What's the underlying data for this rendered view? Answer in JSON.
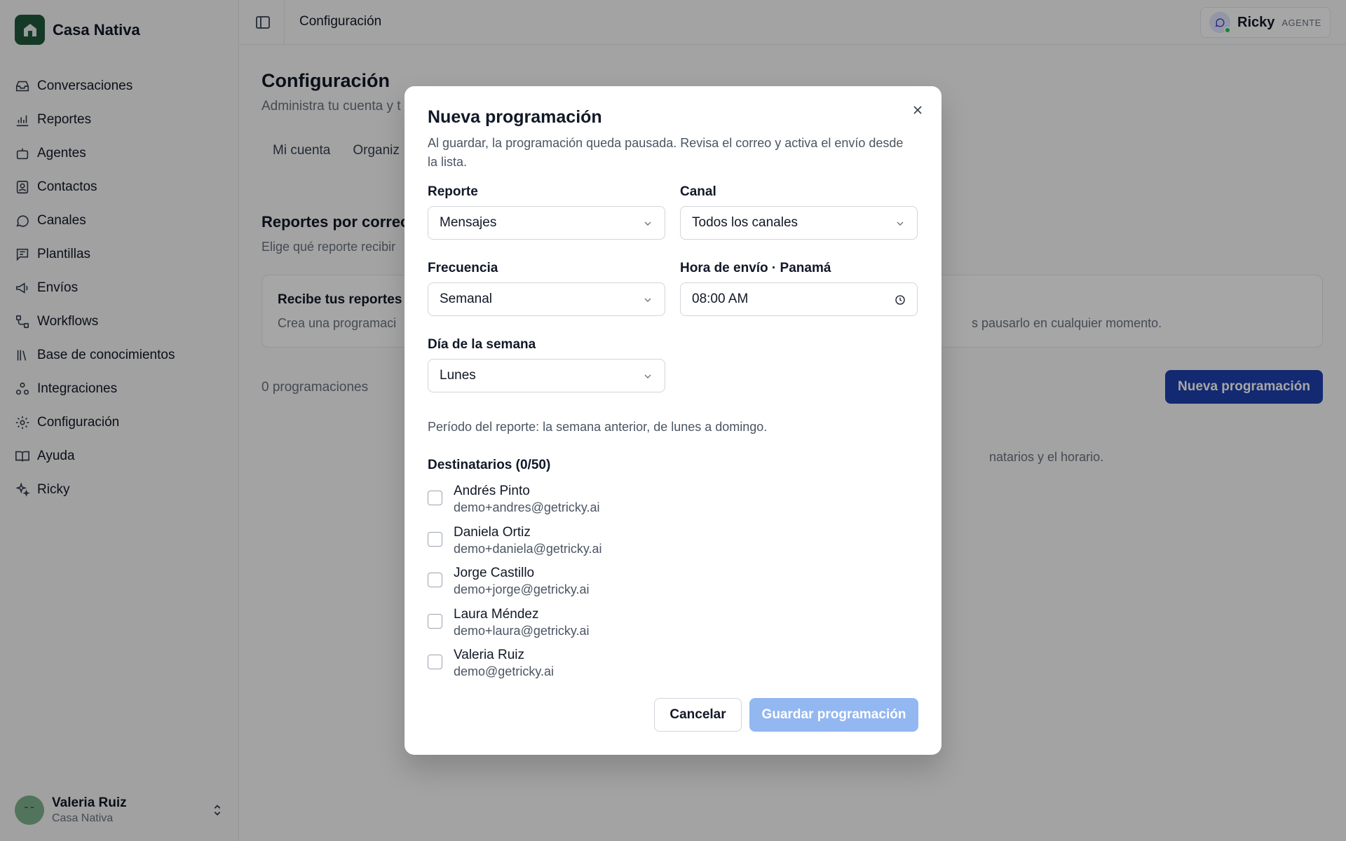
{
  "brand": {
    "name": "Casa Nativa"
  },
  "nav": {
    "items": [
      {
        "label": "Conversaciones",
        "icon": "inbox-icon"
      },
      {
        "label": "Reportes",
        "icon": "chart-icon"
      },
      {
        "label": "Agentes",
        "icon": "bot-icon"
      },
      {
        "label": "Contactos",
        "icon": "contact-icon"
      },
      {
        "label": "Canales",
        "icon": "chat-icon"
      },
      {
        "label": "Plantillas",
        "icon": "template-icon"
      },
      {
        "label": "Envíos",
        "icon": "megaphone-icon"
      },
      {
        "label": "Workflows",
        "icon": "workflow-icon"
      },
      {
        "label": "Base de conocimientos",
        "icon": "library-icon"
      },
      {
        "label": "Integraciones",
        "icon": "integrations-icon"
      },
      {
        "label": "Configuración",
        "icon": "gear-icon"
      },
      {
        "label": "Ayuda",
        "icon": "book-icon"
      },
      {
        "label": "Ricky",
        "icon": "sparkles-icon"
      }
    ]
  },
  "user": {
    "name": "Valeria Ruiz",
    "org": "Casa Nativa",
    "avatar_glyph": "˘ ˘"
  },
  "topbar": {
    "breadcrumb": "Configuración",
    "agent_name": "Ricky",
    "agent_role": "AGENTE"
  },
  "page": {
    "title": "Configuración",
    "subtitle": "Administra tu cuenta y t",
    "tabs": [
      "Mi cuenta",
      "Organiz"
    ],
    "section_title": "Reportes por correo",
    "section_subtitle": "Elige qué reporte recibir",
    "info_title": "Recibe tus reportes",
    "info_text_left": "Crea una programaci",
    "info_text_right": "s pausarlo en cualquier momento.",
    "count": "0 programaciones",
    "new_button": "Nueva programación",
    "empty_fragment": "natarios y el horario."
  },
  "modal": {
    "title": "Nueva programación",
    "description": "Al guardar, la programación queda pausada. Revisa el correo y activa el envío desde la lista.",
    "report_label": "Reporte",
    "report_value": "Mensajes",
    "channel_label": "Canal",
    "channel_value": "Todos los canales",
    "frequency_label": "Frecuencia",
    "frequency_value": "Semanal",
    "time_label": "Hora de envío · Panamá",
    "time_value": "08:00 AM",
    "weekday_label": "Día de la semana",
    "weekday_value": "Lunes",
    "period_text": "Período del reporte: la semana anterior, de lunes a domingo.",
    "recipients_label": "Destinatarios (0/50)",
    "recipients": [
      {
        "name": "Andrés Pinto",
        "email": "demo+andres@getricky.ai"
      },
      {
        "name": "Daniela Ortiz",
        "email": "demo+daniela@getricky.ai"
      },
      {
        "name": "Jorge Castillo",
        "email": "demo+jorge@getricky.ai"
      },
      {
        "name": "Laura Méndez",
        "email": "demo+laura@getricky.ai"
      },
      {
        "name": "Valeria Ruiz",
        "email": "demo@getricky.ai"
      }
    ],
    "cancel_label": "Cancelar",
    "save_label": "Guardar programación"
  },
  "colors": {
    "brand": "#1f5a3c",
    "primary": "#1e40af",
    "primary_disabled": "#93b7f0",
    "online": "#22c55e"
  }
}
